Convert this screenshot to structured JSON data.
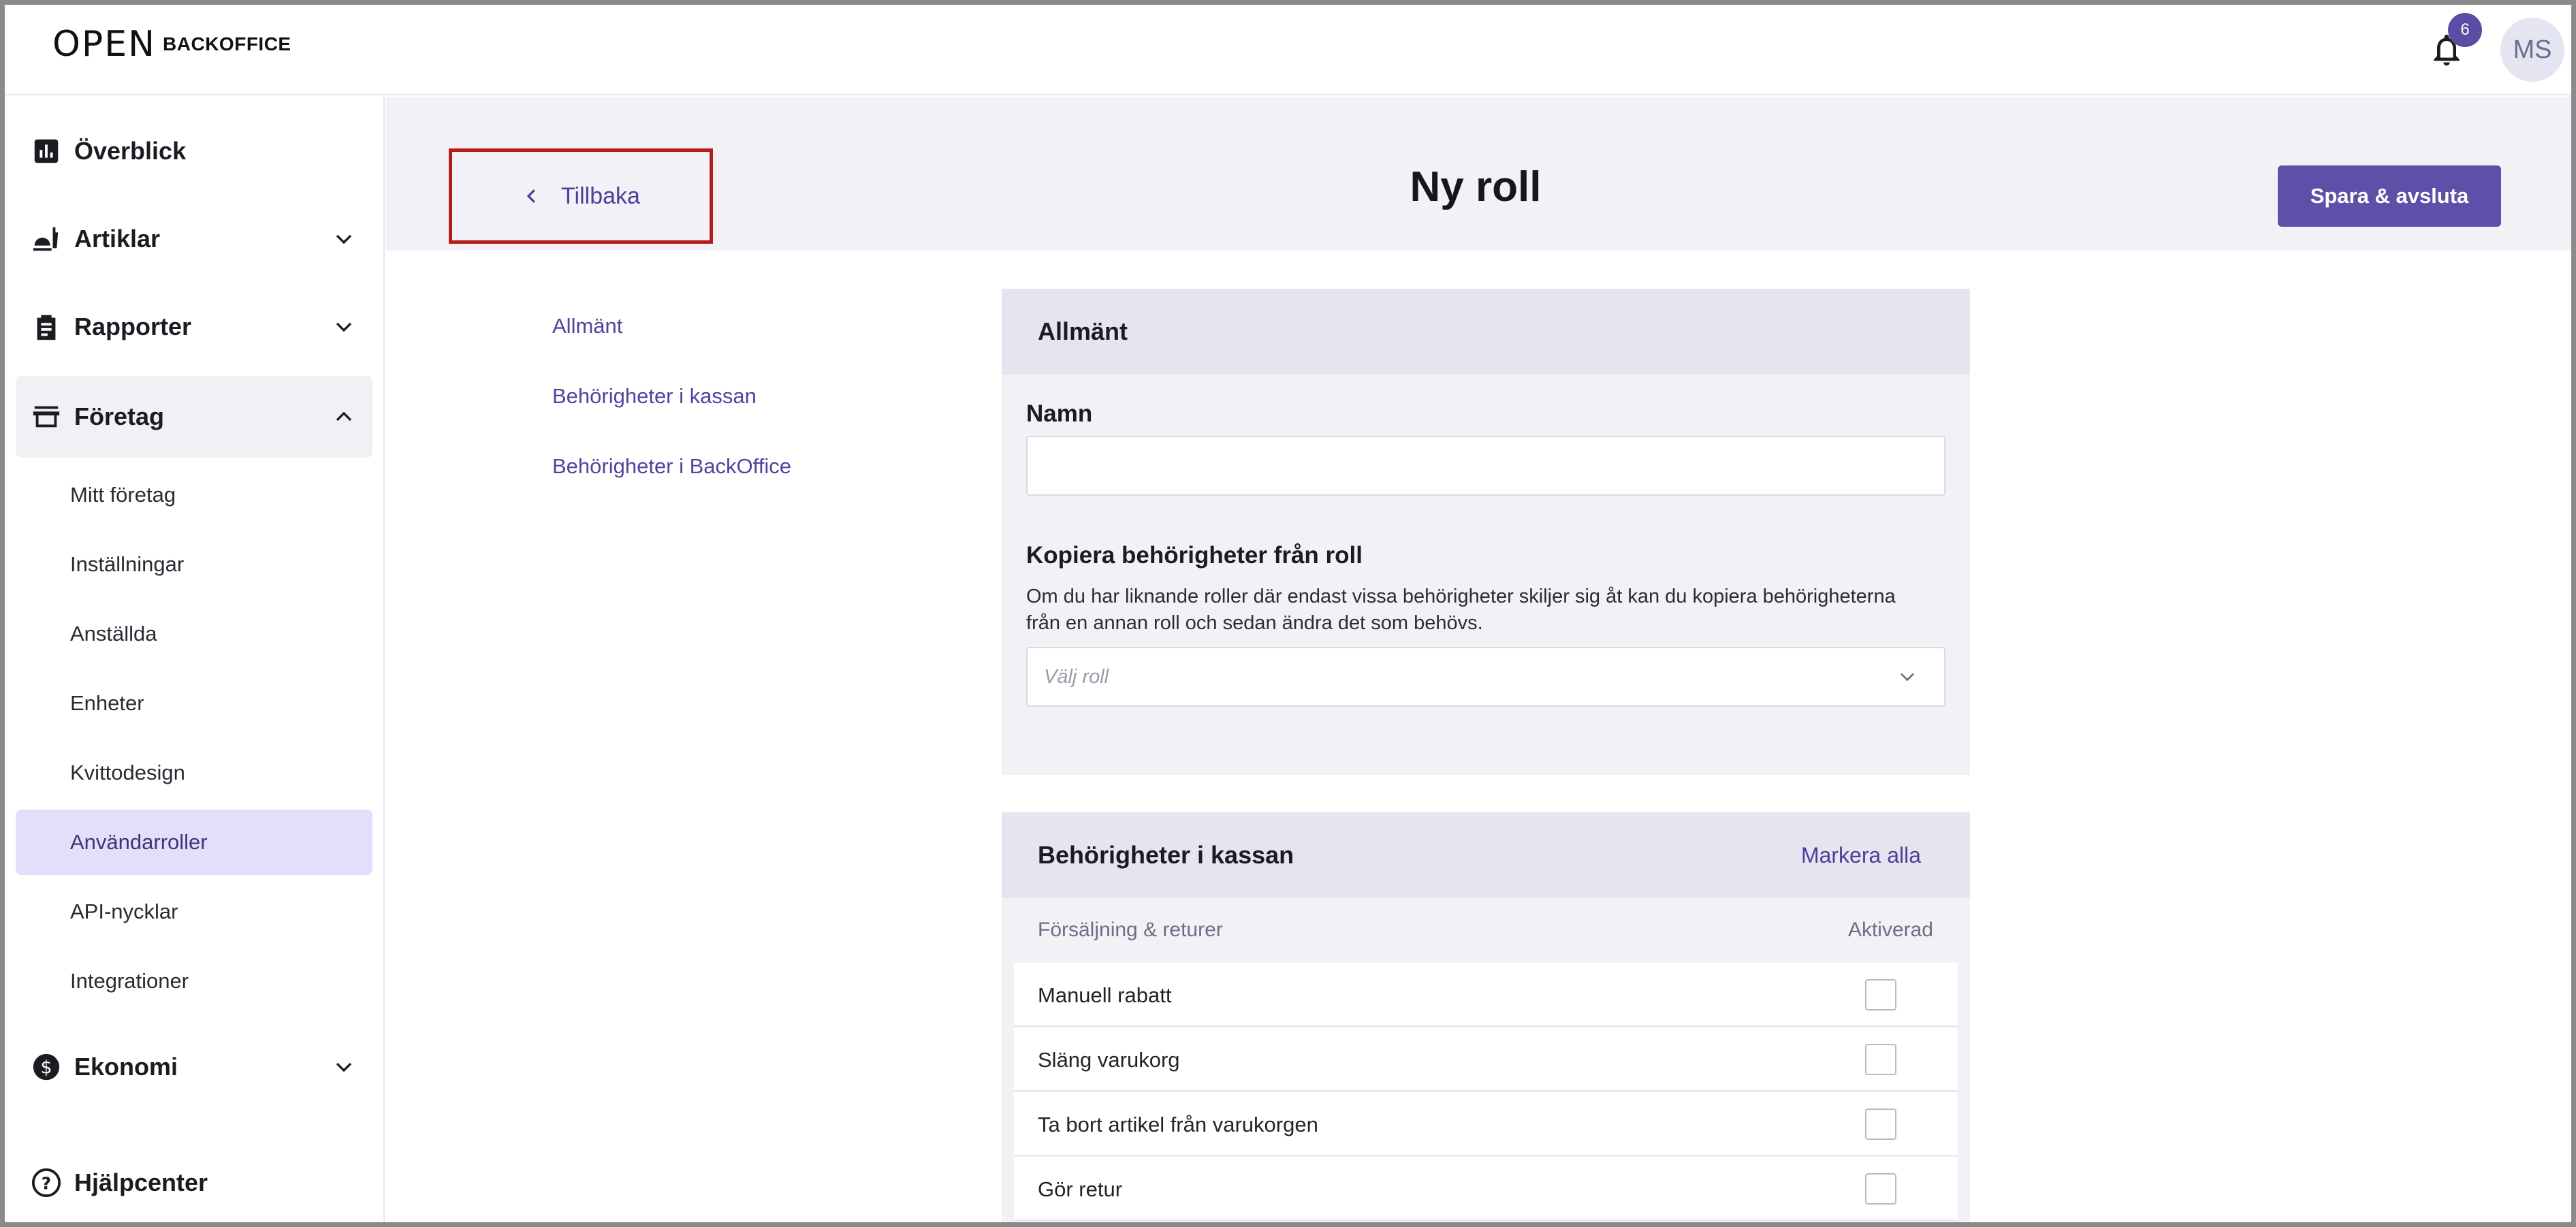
{
  "topbar": {
    "logo_mark": "OPEN",
    "logo_text": "BACKOFFICE",
    "notification_count": "6",
    "avatar_initials": "MS"
  },
  "sidebar": {
    "overview": "Överblick",
    "articles": "Artiklar",
    "reports": "Rapporter",
    "company": "Företag",
    "company_items": [
      "Mitt företag",
      "Inställningar",
      "Anställda",
      "Enheter",
      "Kvittodesign",
      "Användarroller",
      "API-nycklar",
      "Integrationer"
    ],
    "economy": "Ekonomi",
    "help": "Hjälpcenter"
  },
  "header": {
    "back_label": "Tillbaka",
    "title": "Ny roll",
    "save_label": "Spara & avsluta"
  },
  "anchors": [
    "Allmänt",
    "Behörigheter i kassan",
    "Behörigheter i BackOffice"
  ],
  "general": {
    "title": "Allmänt",
    "name_label": "Namn",
    "name_value": "",
    "copy_label": "Kopiera behörigheter från roll",
    "copy_help": "Om du har liknande roller där endast vissa behörigheter skiljer sig åt kan du kopiera behörigheterna från en annan roll och sedan ändra det som behövs.",
    "copy_placeholder": "Välj roll"
  },
  "pos_permissions": {
    "title": "Behörigheter i kassan",
    "mark_all": "Markera alla",
    "section_label": "Försäljning & returer",
    "enabled_label": "Aktiverad",
    "rows": [
      "Manuell rabatt",
      "Släng varukorg",
      "Ta bort artikel från varukorgen",
      "Gör retur"
    ],
    "row_checked": [
      false,
      false,
      false,
      false
    ]
  },
  "colors": {
    "accent": "#5e50a8",
    "link": "#4b3f9b",
    "highlight_border": "#b71c1c",
    "active_nav": "#e3dffa"
  }
}
